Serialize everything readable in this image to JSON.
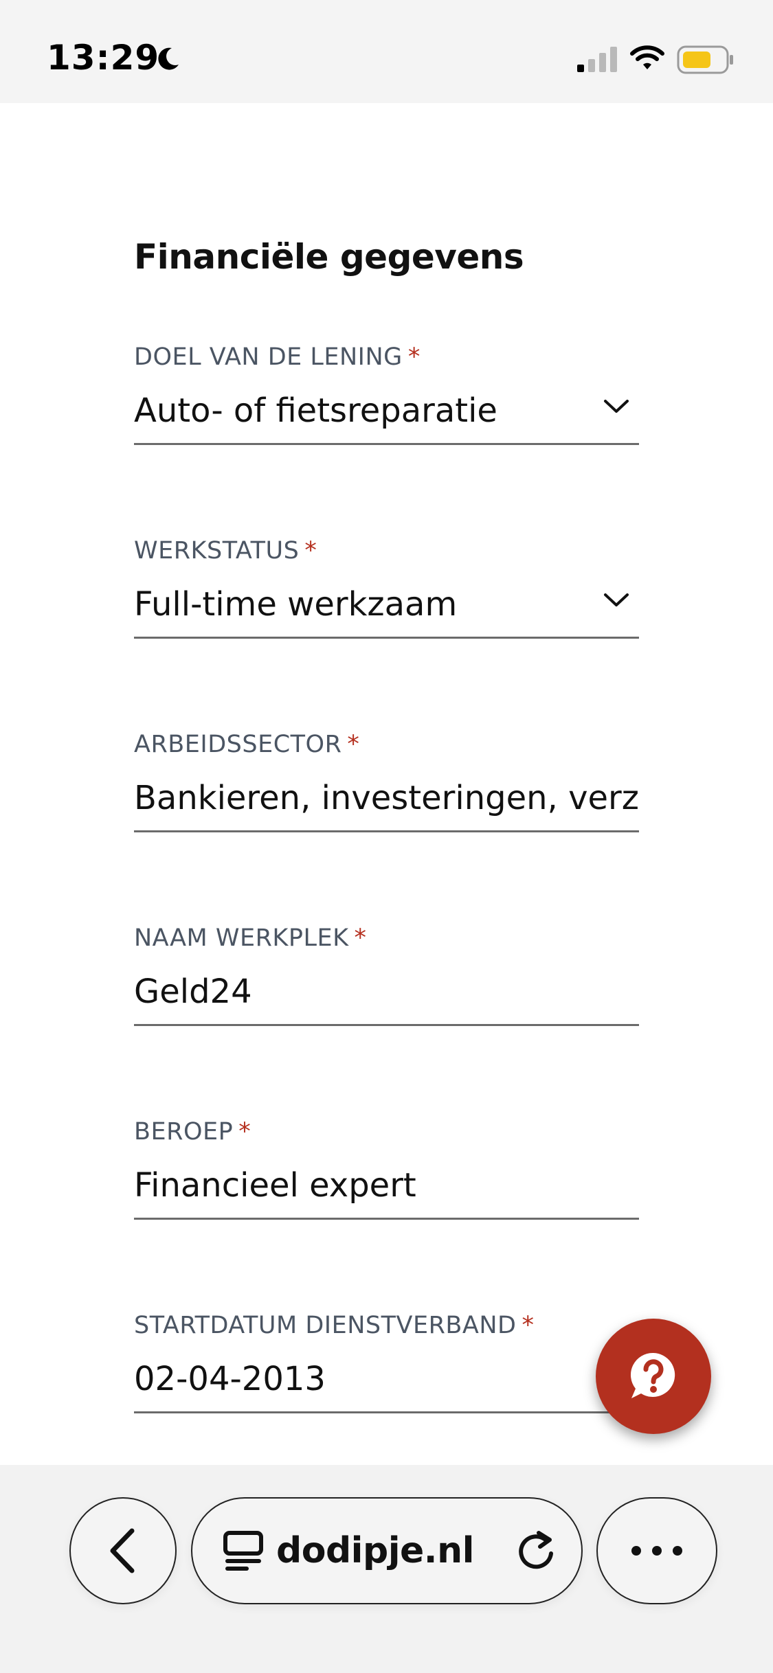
{
  "status_bar": {
    "time": "13:29",
    "icons": [
      "moon-icon",
      "signal-icon",
      "wifi-icon",
      "battery-icon"
    ],
    "battery_color": "#f5c518"
  },
  "form": {
    "section_title": "Financiële gegevens",
    "required_marker": "*",
    "required_color": "#b5301f",
    "fields": [
      {
        "label": "DOEL VAN DE LENING",
        "value": "Auto- of fietsreparatie",
        "type": "select"
      },
      {
        "label": "WERKSTATUS",
        "value": "Full-time werkzaam",
        "type": "select"
      },
      {
        "label": "ARBEIDSSECTOR",
        "value": "Bankieren, investeringen, verzekeringen",
        "type": "select"
      },
      {
        "label": "NAAM WERKPLEK",
        "value": "Geld24",
        "type": "text"
      },
      {
        "label": "BEROEP",
        "value": "Financieel expert",
        "type": "text"
      },
      {
        "label": "STARTDATUM DIENSTVERBAND",
        "value": "02-04-2013",
        "type": "date"
      }
    ]
  },
  "help_button": {
    "icon": "help-chat-icon",
    "color": "#b3301f"
  },
  "browser_bar": {
    "url": "dodipje.nl",
    "back_icon": "chevron-left-icon",
    "reader_icon": "reader-mode-icon",
    "reload_icon": "reload-icon",
    "more_icon": "more-dots-icon"
  }
}
